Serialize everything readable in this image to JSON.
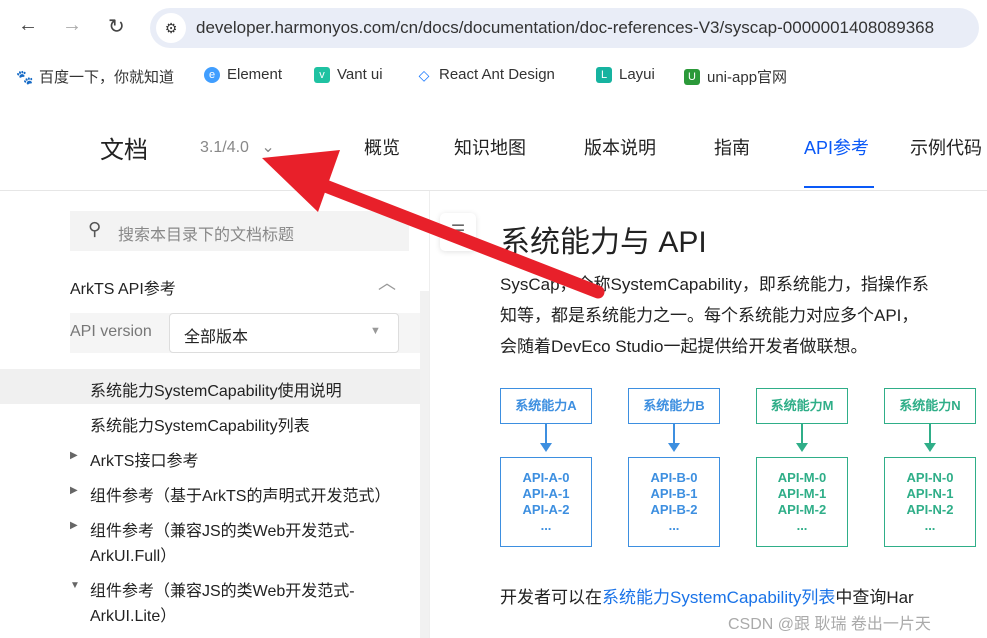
{
  "browser": {
    "url": "developer.harmonyos.com/cn/docs/documentation/doc-references-V3/syscap-0000001408089368",
    "bookmarks": [
      {
        "label": "百度一下，你就知道"
      },
      {
        "label": "Element"
      },
      {
        "label": "Vant ui"
      },
      {
        "label": "React Ant Design"
      },
      {
        "label": "Layui"
      },
      {
        "label": "uni-app官网"
      }
    ]
  },
  "header": {
    "title": "文档",
    "version": "3.1/4.0",
    "nav": [
      {
        "label": "概览"
      },
      {
        "label": "知识地图"
      },
      {
        "label": "版本说明"
      },
      {
        "label": "指南"
      },
      {
        "label": "API参考"
      },
      {
        "label": "示例代码"
      }
    ],
    "accent": "#0a59f7"
  },
  "sidebar": {
    "search_placeholder": "搜索本目录下的文档标题",
    "section": "ArkTS API参考",
    "api_version_label": "API version",
    "api_version_value": "全部版本",
    "items": [
      {
        "label": "系统能力SystemCapability使用说明"
      },
      {
        "label": "系统能力SystemCapability列表"
      },
      {
        "label": "ArkTS接口参考"
      },
      {
        "label": "组件参考（基于ArkTS的声明式开发范式）"
      },
      {
        "label": "组件参考（兼容JS的类Web开发范式-",
        "label2": "ArkUI.Full）"
      },
      {
        "label": "组件参考（兼容JS的类Web开发范式-",
        "label2": "ArkUI.Lite）"
      }
    ]
  },
  "content": {
    "title": "系统能力与 API",
    "para": [
      "SysCap，全称SystemCapability，即系统能力，指操作系",
      "知等，都是系统能力之一。每个系统能力对应多个API，",
      "会随着DevEco Studio一起提供给开发者做联想。"
    ],
    "diagram": [
      {
        "cap": "系统能力A",
        "apis": [
          "API-A-0",
          "API-A-1",
          "API-A-2",
          "..."
        ],
        "color": "#3d8fe0"
      },
      {
        "cap": "系统能力B",
        "apis": [
          "API-B-0",
          "API-B-1",
          "API-B-2",
          "..."
        ],
        "color": "#3d8fe0"
      },
      {
        "cap": "系统能力M",
        "apis": [
          "API-M-0",
          "API-M-1",
          "API-M-2",
          "..."
        ],
        "color": "#2fae88"
      },
      {
        "cap": "系统能力N",
        "apis": [
          "API-N-0",
          "API-N-1",
          "API-N-2",
          "..."
        ],
        "color": "#2fae88"
      }
    ],
    "footer_pre": "开发者可以在",
    "footer_link": "系统能力SystemCapability列表",
    "footer_post": "中查询Har"
  },
  "watermark": "CSDN @跟 耿瑞 卷出一片天",
  "annotation_color": "#e8202a"
}
